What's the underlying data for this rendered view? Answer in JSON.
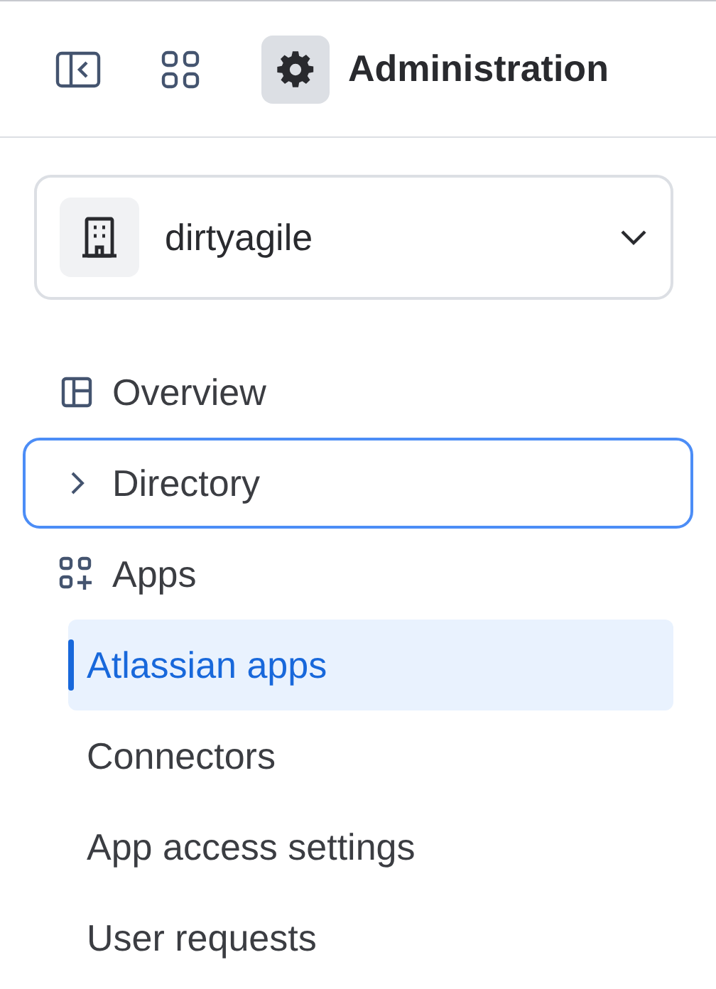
{
  "header": {
    "title": "Administration"
  },
  "org_switcher": {
    "name": "dirtyagile"
  },
  "nav": [
    {
      "kind": "overview",
      "label": "Overview",
      "focused": false
    },
    {
      "kind": "directory",
      "label": "Directory",
      "focused": true
    },
    {
      "kind": "apps",
      "label": "Apps",
      "focused": false,
      "children": [
        {
          "label": "Atlassian apps",
          "selected": true
        },
        {
          "label": "Connectors",
          "selected": false
        },
        {
          "label": "App access settings",
          "selected": false
        },
        {
          "label": "User requests",
          "selected": false
        }
      ]
    }
  ]
}
